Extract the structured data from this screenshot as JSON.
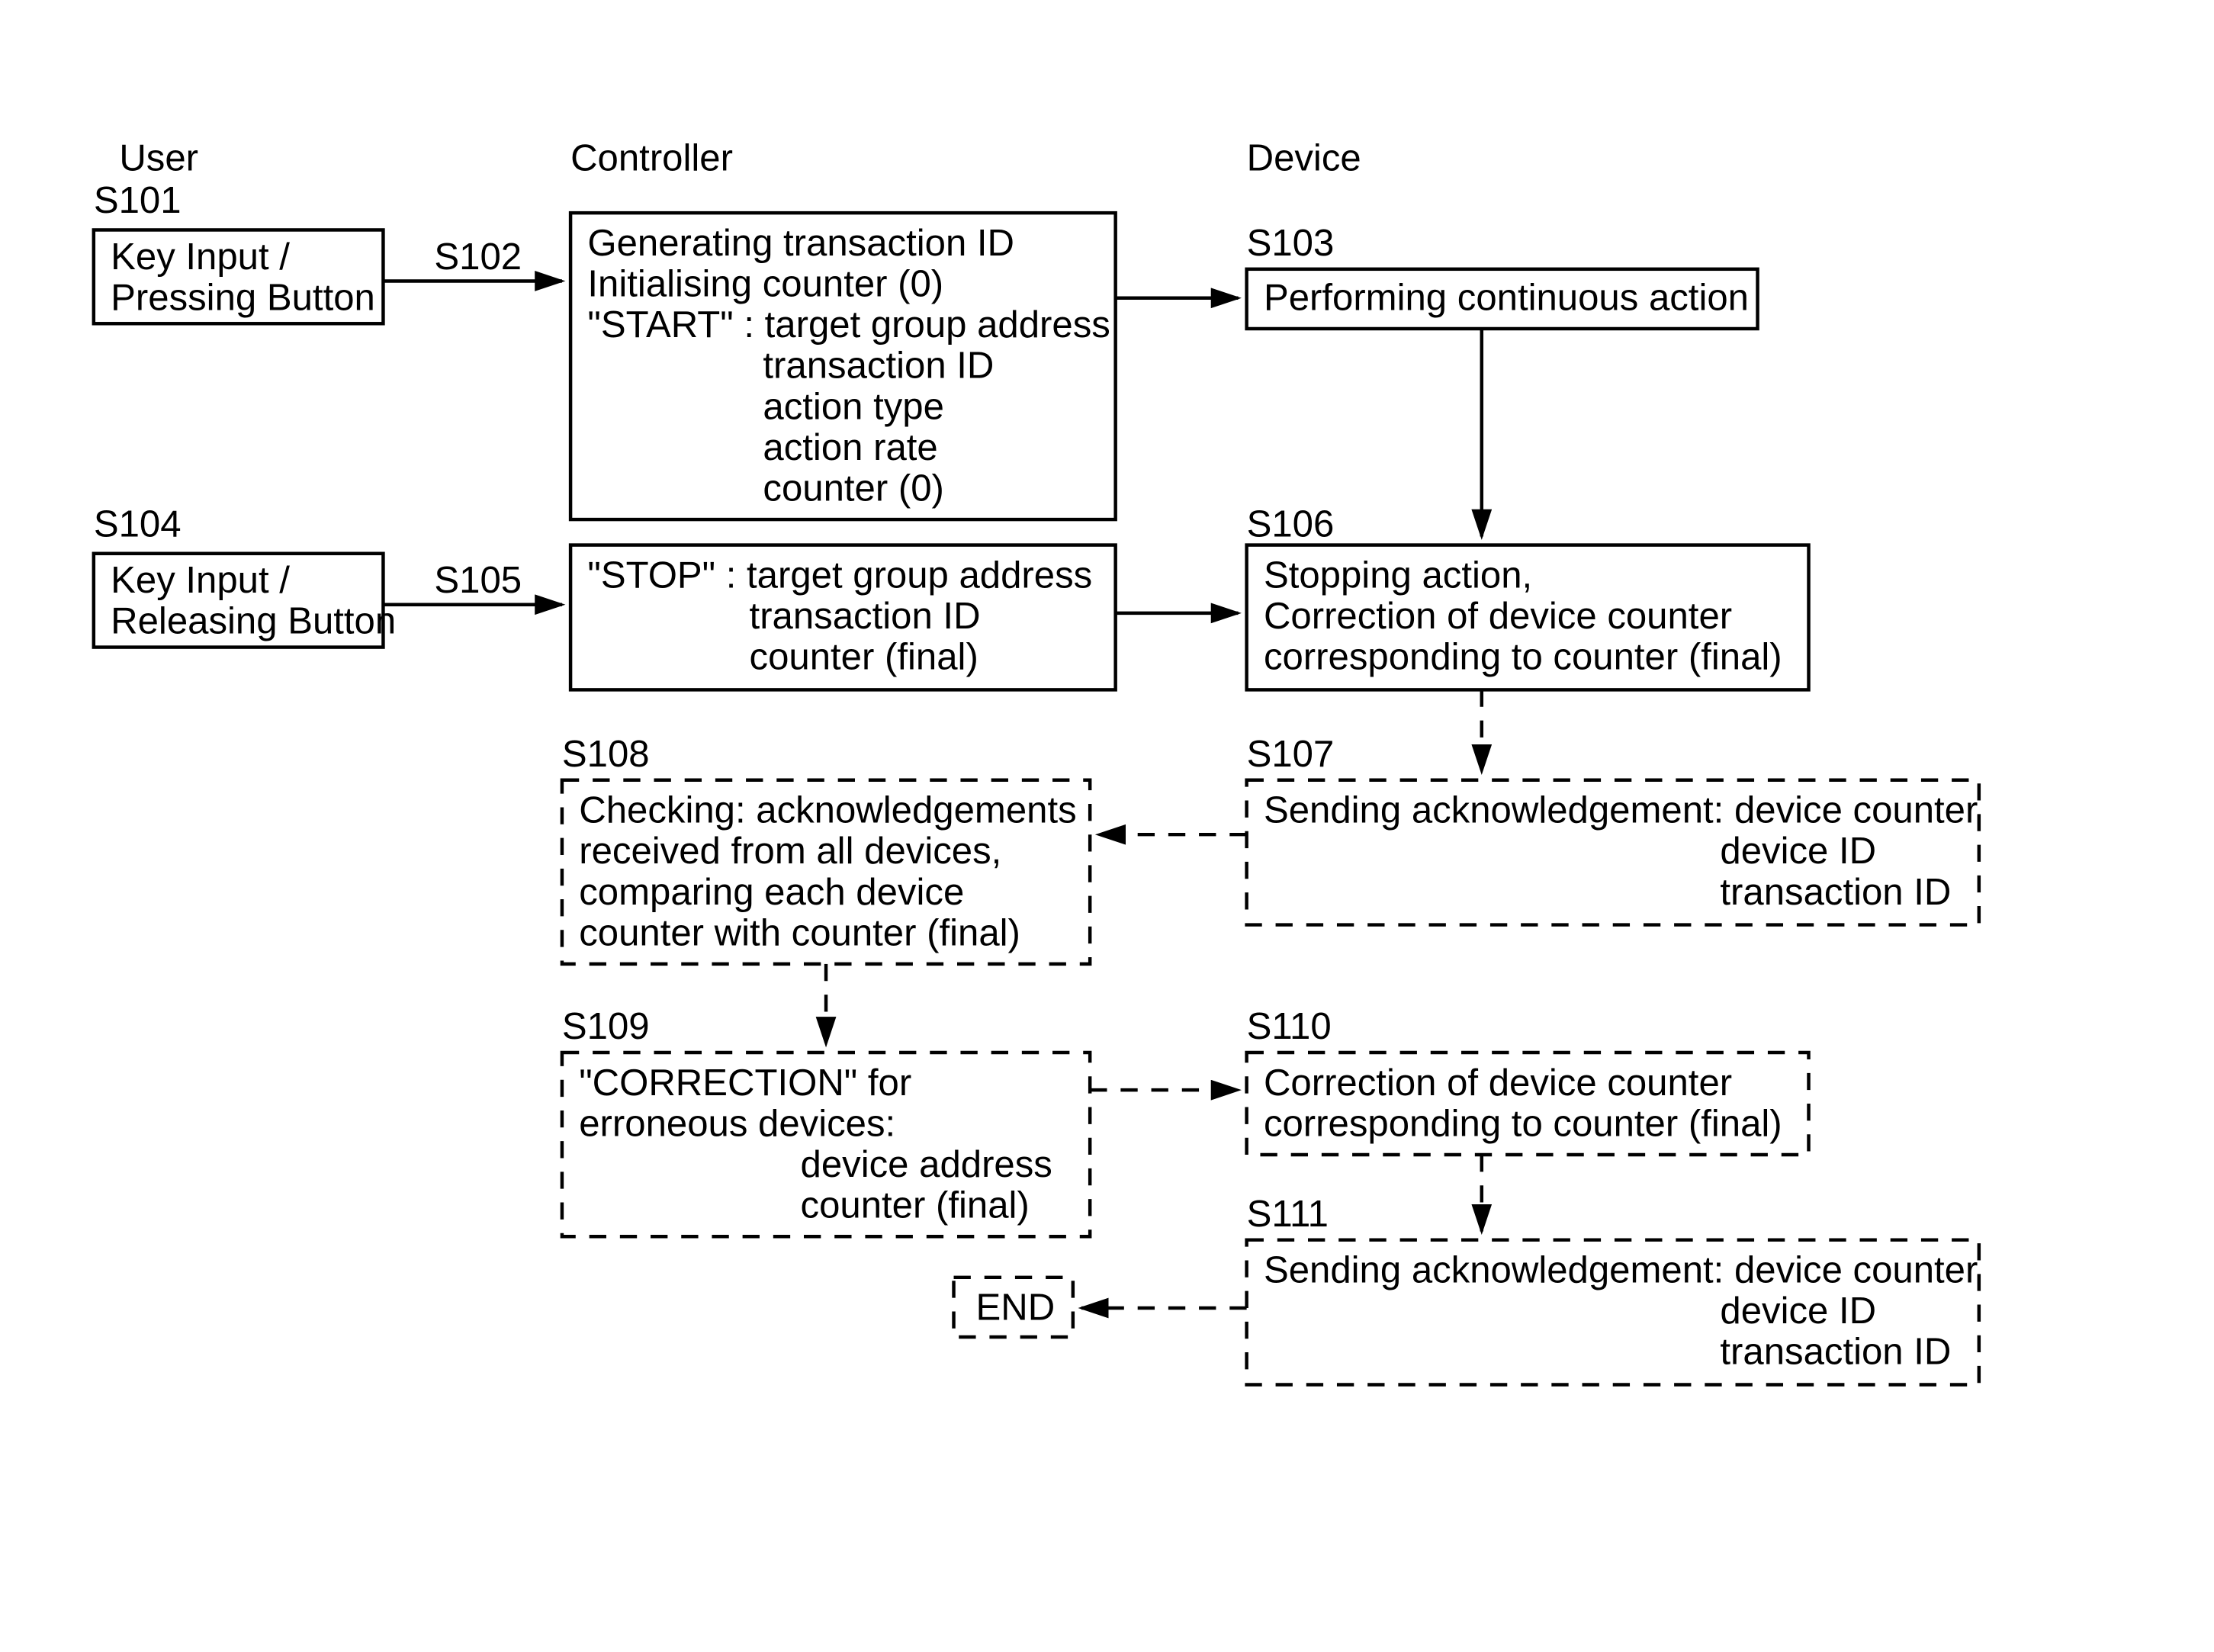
{
  "columns": {
    "user": "User",
    "controller": "Controller",
    "device": "Device"
  },
  "steps": {
    "s101": {
      "tag": "S101",
      "line1": "Key Input /",
      "line2": "Pressing Button"
    },
    "s102": {
      "tag": "S102",
      "line1": "Generating transaction ID",
      "line2": "Initialising counter (0)",
      "line3": "\"START\" : target group address",
      "line4": "transaction ID",
      "line5": "action type",
      "line6": "action rate",
      "line7": "counter (0)"
    },
    "s103": {
      "tag": "S103",
      "txt": "Performing continuous action"
    },
    "s104": {
      "tag": "S104",
      "line1": "Key Input /",
      "line2": "Releasing Button"
    },
    "s105": {
      "tag": "S105",
      "line1": "\"STOP\" : target group address",
      "line2": "transaction ID",
      "line3": "counter (final)"
    },
    "s106": {
      "tag": "S106",
      "line1": "Stopping action,",
      "line2": "Correction of device counter",
      "line3": "corresponding to counter (final)"
    },
    "s107": {
      "tag": "S107",
      "line1": "Sending acknowledgement: device counter",
      "line2": "device ID",
      "line3": "transaction ID"
    },
    "s108": {
      "tag": "S108",
      "line1": "Checking: acknowledgements",
      "line2": "received from all devices,",
      "line3": "comparing each device",
      "line4": "counter with counter (final)"
    },
    "s109": {
      "tag": "S109",
      "line1": "\"CORRECTION\" for",
      "line2": "erroneous devices:",
      "line3": "device address",
      "line4": "counter (final)"
    },
    "s110": {
      "tag": "S110",
      "line1": "Correction of device counter",
      "line2": "corresponding to counter (final)"
    },
    "s111": {
      "tag": "S111",
      "line1": "Sending acknowledgement: device counter",
      "line2": "device ID",
      "line3": "transaction ID"
    },
    "end": {
      "txt": "END"
    }
  }
}
